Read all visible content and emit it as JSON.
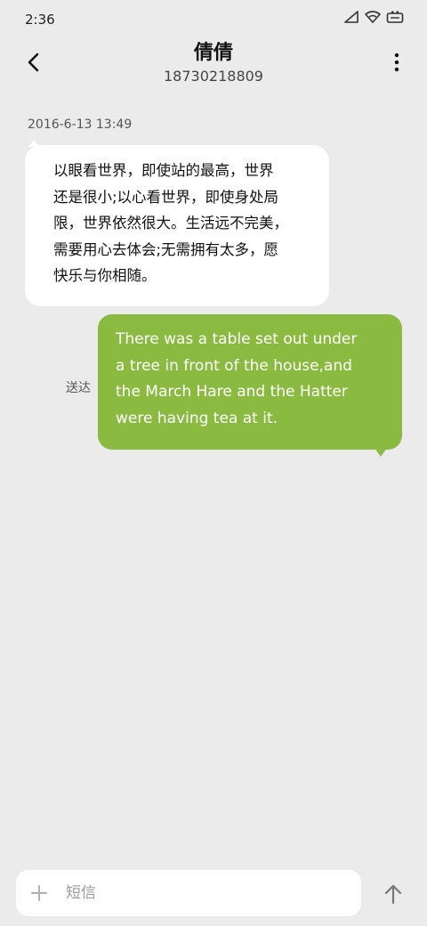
{
  "status_bar": {
    "time": "2:36",
    "icons": [
      "signal-icon",
      "wifi-icon",
      "battery-icon"
    ]
  },
  "header": {
    "contact_name": "倩倩",
    "contact_number": "18730218809",
    "back_icon": "chevron-left-icon",
    "menu_icon": "more-vertical-icon"
  },
  "conversation": {
    "timestamp": "2016-6-13 13:49",
    "messages": [
      {
        "direction": "incoming",
        "lines": [
          "以眼看世界，即使站的最高，世界",
          "还是很小;以心看世界，即使身处局",
          "限，世界依然很大。生活远不完美，",
          "需要用心去体会;无需拥有太多，愿",
          "快乐与你相随。"
        ]
      },
      {
        "direction": "outgoing",
        "status": "送达",
        "lines": [
          "There was a table set out under",
          "a tree in front of the house,and",
          "the March Hare and the Hatter",
          "were having tea at it."
        ]
      }
    ]
  },
  "composer": {
    "placeholder": "短信",
    "plus_icon": "plus-icon",
    "send_icon": "arrow-up-icon"
  },
  "colors": {
    "background": "#ebebeb",
    "incoming_bubble": "#ffffff",
    "outgoing_bubble": "#8bba40"
  }
}
